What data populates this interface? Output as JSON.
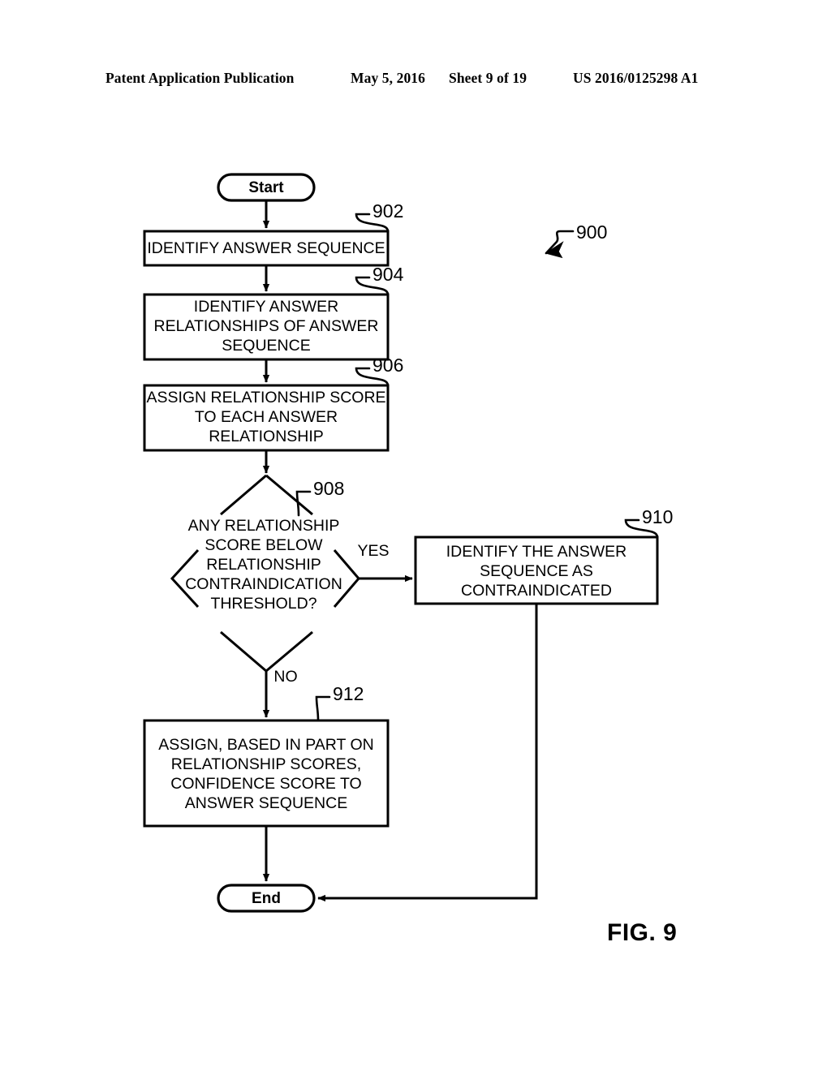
{
  "header": {
    "publication": "Patent Application Publication",
    "date": "May 5, 2016",
    "sheet": "Sheet 9 of 19",
    "patent_number": "US 2016/0125298 A1"
  },
  "figure": {
    "label": "FIG. 9",
    "diagram_ref": "900"
  },
  "flowchart": {
    "type": "flowchart",
    "start": {
      "label": "Start"
    },
    "end": {
      "label": "End"
    },
    "nodes": [
      {
        "ref": "902",
        "shape": "process",
        "lines": [
          "IDENTIFY ANSWER SEQUENCE"
        ]
      },
      {
        "ref": "904",
        "shape": "process",
        "lines": [
          "IDENTIFY ANSWER",
          "RELATIONSHIPS OF ANSWER",
          "SEQUENCE"
        ]
      },
      {
        "ref": "906",
        "shape": "process",
        "lines": [
          "ASSIGN RELATIONSHIP SCORE",
          "TO EACH ANSWER",
          "RELATIONSHIP"
        ]
      },
      {
        "ref": "908",
        "shape": "decision",
        "lines": [
          "ANY RELATIONSHIP",
          "SCORE BELOW",
          "RELATIONSHIP",
          "CONTRAINDICATION",
          "THRESHOLD?"
        ]
      },
      {
        "ref": "910",
        "shape": "process",
        "lines": [
          "IDENTIFY THE ANSWER",
          "SEQUENCE AS",
          "CONTRAINDICATED"
        ]
      },
      {
        "ref": "912",
        "shape": "process",
        "lines": [
          "ASSIGN, BASED IN PART ON",
          "RELATIONSHIP SCORES,",
          "CONFIDENCE SCORE TO",
          "ANSWER SEQUENCE"
        ]
      }
    ],
    "edge_labels": {
      "yes": "YES",
      "no": "NO"
    },
    "colors": {
      "stroke": "#000000",
      "fill": "#ffffff"
    }
  }
}
